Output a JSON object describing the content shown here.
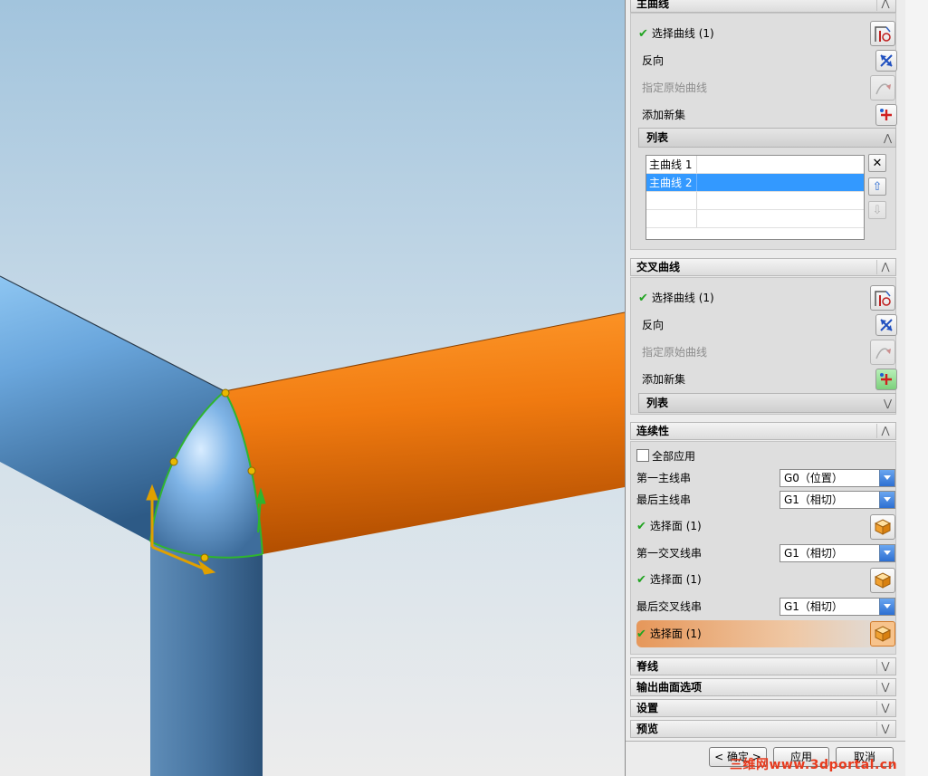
{
  "panel": {
    "primary": {
      "title": "主曲线",
      "select_curve": "选择曲线 (1)",
      "reverse": "反向",
      "specify_origin": "指定原始曲线",
      "add_new_set": "添加新集",
      "list": {
        "title": "列表",
        "items": [
          "主曲线 1",
          "主曲线 2"
        ],
        "selected_index": 1
      }
    },
    "cross": {
      "title": "交叉曲线",
      "select_curve": "选择曲线 (1)",
      "reverse": "反向",
      "specify_origin": "指定原始曲线",
      "add_new_set": "添加新集",
      "list_title": "列表"
    },
    "continuity": {
      "title": "连续性",
      "apply_all": "全部应用",
      "apply_all_checked": false,
      "first_primary": {
        "label": "第一主线串",
        "value": "G0（位置）"
      },
      "last_primary": {
        "label": "最后主线串",
        "value": "G1（相切）"
      },
      "select_face_1": "选择面 (1)",
      "first_cross": {
        "label": "第一交叉线串",
        "value": "G1（相切）"
      },
      "select_face_2": "选择面 (1)",
      "last_cross": {
        "label": "最后交叉线串",
        "value": "G1（相切）"
      },
      "select_face_3": "选择面 (1)"
    },
    "collapsed": [
      "脊线",
      "输出曲面选项",
      "设置",
      "预览"
    ],
    "buttons": {
      "ok": "< 确定 >",
      "apply": "应用",
      "cancel": "取消"
    }
  },
  "watermark": "三维网www.3dportal.cn",
  "colors": {
    "viewport_top": "#a4c6de",
    "viewport_bottom": "#ececec",
    "blue_tube": "#6aa6dc",
    "orange_tube": "#f07a10",
    "green_curve": "#2fb42f",
    "selection": "#3399ff"
  }
}
